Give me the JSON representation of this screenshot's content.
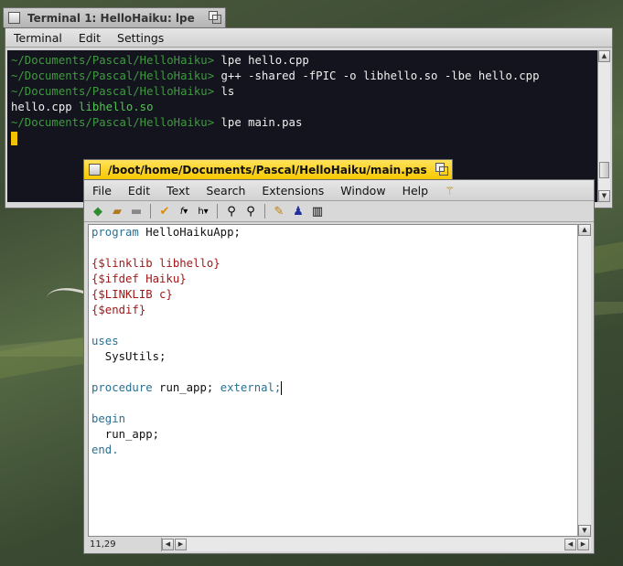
{
  "terminal": {
    "title": "Terminal 1: HelloHaiku: lpe",
    "menu": [
      "Terminal",
      "Edit",
      "Settings"
    ],
    "lines": [
      {
        "prompt": "~/Documents/Pascal/HelloHaiku>",
        "command": " lpe hello.cpp"
      },
      {
        "prompt": "~/Documents/Pascal/HelloHaiku>",
        "command": " g++ -shared -fPIC -o libhello.so -lbe  hello.cpp"
      },
      {
        "prompt": "~/Documents/Pascal/HelloHaiku>",
        "command": " ls"
      }
    ],
    "ls_output": {
      "file1": "hello.cpp",
      "file2": "libhello.so"
    },
    "last_line": {
      "prompt": "~/Documents/Pascal/HelloHaiku>",
      "command": " lpe main.pas"
    }
  },
  "editor": {
    "title": "/boot/home/Documents/Pascal/HelloHaiku/main.pas",
    "menu": [
      "File",
      "Edit",
      "Text",
      "Search",
      "Extensions",
      "Window",
      "Help"
    ],
    "code": {
      "l1_kw": "program",
      "l1_rest": " HelloHaikuApp;",
      "l3": "{$linklib libhello}",
      "l4": "{$ifdef Haiku}",
      "l5": "{$LINKLIB c}",
      "l6": "{$endif}",
      "l8": "uses",
      "l9": "  SysUtils;",
      "l11_kw": "procedure",
      "l11_name": " run_app; ",
      "l11_ext": "external;",
      "l13": "begin",
      "l14": "  run_app;",
      "l15": "end."
    },
    "status_position": "11,29"
  },
  "colors": {
    "editor_tab": "#f7c800",
    "terminal_bg": "#14141e",
    "prompt": "#3f9a3f",
    "keyword": "#2a7090",
    "directive": "#a01818"
  }
}
